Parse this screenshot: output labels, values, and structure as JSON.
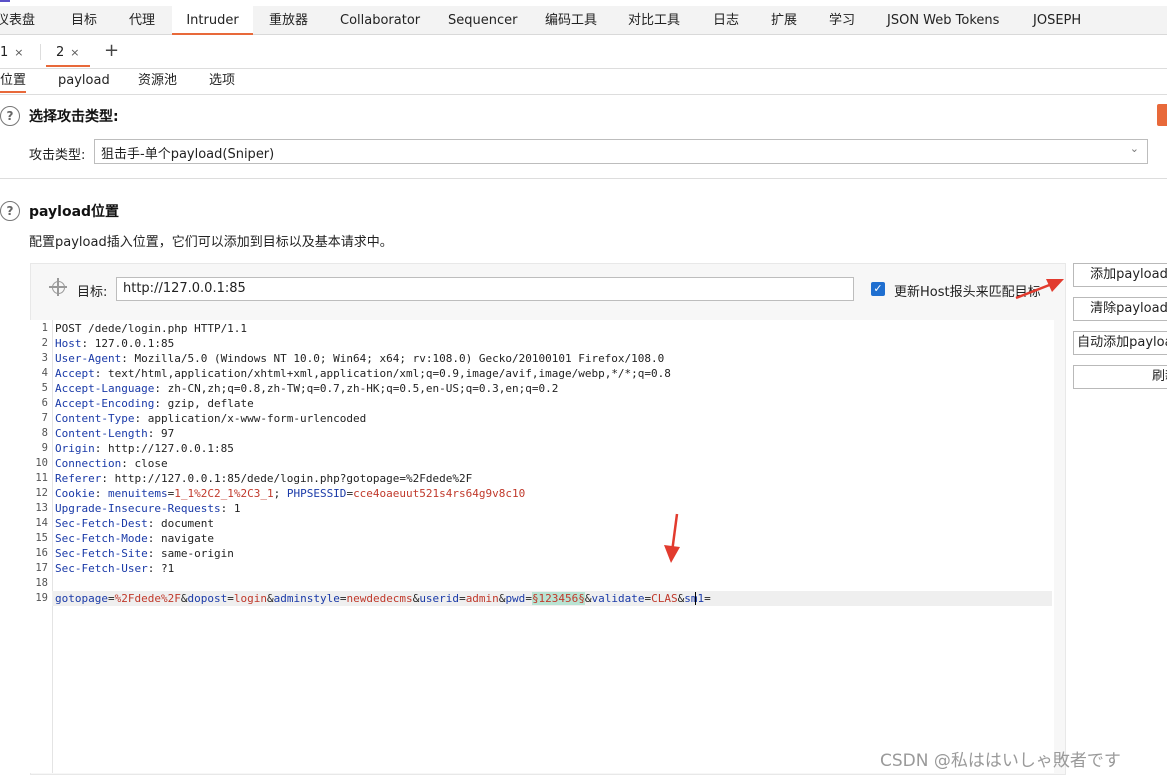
{
  "menubar": {
    "items": [
      "仪表盘",
      "目标",
      "代理",
      "Intruder",
      "重放器",
      "Collaborator",
      "Sequencer",
      "编码工具",
      "对比工具",
      "日志",
      "扩展",
      "学习",
      "JSON Web Tokens",
      "JOSEPH"
    ],
    "active": "Intruder"
  },
  "tabs": [
    {
      "label": "1",
      "close": "×"
    },
    {
      "label": "2",
      "close": "×"
    }
  ],
  "new_tab": "+",
  "sections": [
    "位置",
    "payload",
    "资源池",
    "选项"
  ],
  "attack_type": {
    "heading": "选择攻击类型:",
    "label": "攻击类型:",
    "value": "狙击手-单个payload(Sniper)"
  },
  "payload_positions": {
    "heading": "payload位置",
    "description": "配置payload插入位置，它们可以添加到目标以及基本请求中。",
    "target_label": "目标:",
    "target_value": "http://127.0.0.1:85",
    "update_host_label": "更新Host报头来匹配目标",
    "update_host_checked": true
  },
  "buttons": {
    "add": "添加payload",
    "clear": "清除payload",
    "auto": "自动添加payload",
    "refresh": "刷新"
  },
  "request_lines": [
    {
      "n": "1",
      "text": "POST /dede/login.php HTTP/1.1"
    },
    {
      "n": "2",
      "key": "Host",
      "value": "127.0.0.1:85"
    },
    {
      "n": "3",
      "key": "User-Agent",
      "value": "Mozilla/5.0 (Windows NT 10.0; Win64; x64; rv:108.0) Gecko/20100101 Firefox/108.0"
    },
    {
      "n": "4",
      "key": "Accept",
      "value": "text/html,application/xhtml+xml,application/xml;q=0.9,image/avif,image/webp,*/*;q=0.8"
    },
    {
      "n": "5",
      "key": "Accept-Language",
      "value": "zh-CN,zh;q=0.8,zh-TW;q=0.7,zh-HK;q=0.5,en-US;q=0.3,en;q=0.2"
    },
    {
      "n": "6",
      "key": "Accept-Encoding",
      "value": "gzip, deflate"
    },
    {
      "n": "7",
      "key": "Content-Type",
      "value": "application/x-www-form-urlencoded"
    },
    {
      "n": "8",
      "key": "Content-Length",
      "value": "97"
    },
    {
      "n": "9",
      "key": "Origin",
      "value": "http://127.0.0.1:85"
    },
    {
      "n": "10",
      "key": "Connection",
      "value": "close"
    },
    {
      "n": "11",
      "key": "Referer",
      "value": "http://127.0.0.1:85/dede/login.php?gotopage=%2Fdede%2F"
    },
    {
      "n": "12",
      "key": "Cookie",
      "cookie1_name": "menuitems",
      "cookie1_val": "1_1%2C2_1%2C3_1",
      "cookie2_name": "PHPSESSID",
      "cookie2_val": "cce4oaeuut521s4rs64g9v8c10"
    },
    {
      "n": "13",
      "key": "Upgrade-Insecure-Requests",
      "value": "1"
    },
    {
      "n": "14",
      "key": "Sec-Fetch-Dest",
      "value": "document"
    },
    {
      "n": "15",
      "key": "Sec-Fetch-Mode",
      "value": "navigate"
    },
    {
      "n": "16",
      "key": "Sec-Fetch-Site",
      "value": "same-origin"
    },
    {
      "n": "17",
      "key": "Sec-Fetch-User",
      "value": "?1"
    },
    {
      "n": "18"
    },
    {
      "n": "19"
    }
  ],
  "body_params": {
    "p1k": "gotopage",
    "p1v": "%2Fdede%2F",
    "p2k": "dopost",
    "p2v": "login",
    "p3k": "adminstyle",
    "p3v": "newdedecms",
    "p4k": "userid",
    "p4v": "admin",
    "p5k": "pwd",
    "p5v": "§123456§",
    "p6k": "validate",
    "p6v": "CLAS",
    "p7k": "sm1"
  },
  "watermark": "CSDN @私ははいしゃ敗者です",
  "colors": {
    "accent": "#e8693a",
    "key": "#1a3aa8",
    "value": "#c0392b",
    "payload_bg": "#b9e3d3",
    "arrow": "#e23b2e"
  }
}
